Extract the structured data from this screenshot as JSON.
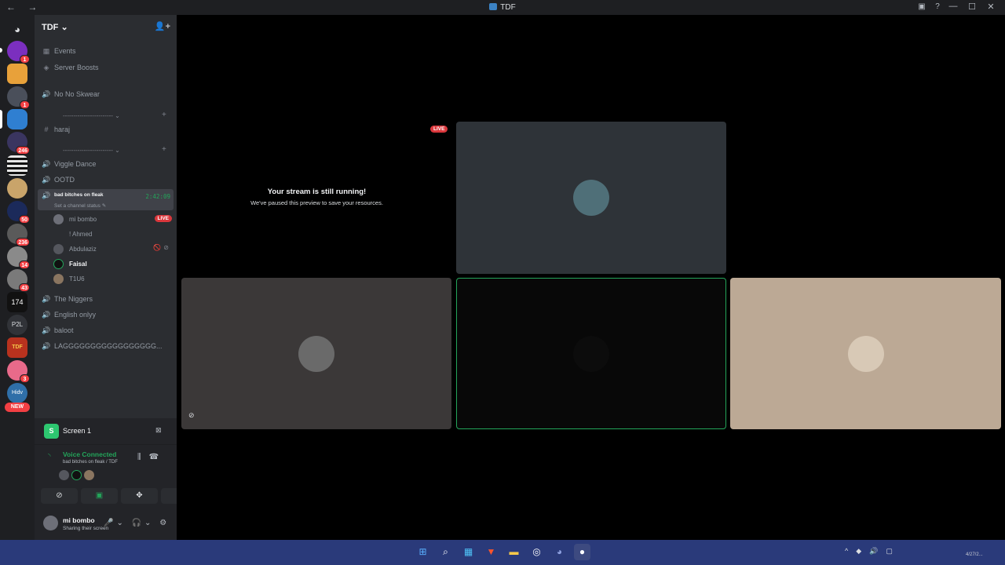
{
  "window": {
    "title": "TDF",
    "nav": "← →",
    "controls": [
      "—",
      "☐",
      "✕"
    ],
    "extra_icons": [
      "▣",
      "?"
    ]
  },
  "servers": [
    {
      "name": "server-1",
      "color": "#7b2fbf",
      "badge": "1"
    },
    {
      "name": "server-2",
      "color": "#e8a13a",
      "badge": ""
    },
    {
      "name": "server-3",
      "color": "#4a4f5a",
      "badge": "1"
    },
    {
      "name": "server-4",
      "color": "#2f7fd1",
      "badge": ""
    },
    {
      "name": "server-5",
      "color": "#3a3560",
      "badge": "246"
    },
    {
      "name": "server-6",
      "color": "#e6e6e6",
      "badge": ""
    },
    {
      "name": "server-7",
      "color": "#c9a46a",
      "badge": ""
    },
    {
      "name": "server-8",
      "color": "#1b2a5a",
      "badge": "50"
    },
    {
      "name": "server-9",
      "color": "#5a5a5a",
      "badge": "236"
    },
    {
      "name": "server-10",
      "color": "#8a8a8a",
      "badge": "14"
    },
    {
      "name": "server-11",
      "color": "#7a7a7a",
      "badge": "43"
    },
    {
      "name": "server-12",
      "color": "#111111",
      "badge": "",
      "text": "174"
    },
    {
      "name": "server-13",
      "color": "#313338",
      "badge": "",
      "text": "P2L"
    },
    {
      "name": "server-14",
      "color": "#b8321e",
      "badge": "",
      "text": "TDF"
    },
    {
      "name": "server-15",
      "color": "#e86a8a",
      "badge": "3"
    },
    {
      "name": "server-16",
      "color": "#2f6fa8",
      "badge": "",
      "text": "Hidv"
    }
  ],
  "new_label": "NEW",
  "guild": {
    "name": "TDF ⌄",
    "items": [
      {
        "icon": "▦",
        "label": "Events"
      },
      {
        "icon": "◈",
        "label": "Server Boosts"
      },
      {
        "icon": "🔊",
        "label": "No No Skwear"
      }
    ],
    "category_1": "------------------------ ⌄",
    "category_2": "------------------------ ⌄",
    "text_channel": "haraj",
    "voice_channels_a": [
      "Viggle Dance",
      "OOTD"
    ],
    "active_channel": {
      "name": "bad bitches on fleak",
      "timer": "2:42:09",
      "status": "Set a channel status ✎"
    },
    "members": [
      {
        "name": "mi bombo",
        "live": "LIVE"
      },
      {
        "name": "! Ahmed",
        "live": ""
      },
      {
        "name": "Abdulaziz",
        "live": ""
      },
      {
        "name": "Faisal",
        "live": ""
      },
      {
        "name": "T1U6",
        "live": ""
      }
    ],
    "voice_channels_b": [
      "The Niggers",
      "English onlyy",
      "baloot",
      "LAGGGGGGGGGGGGGGGGG..."
    ]
  },
  "panel": {
    "screen_label": "Screen 1",
    "screen_icon_text": "S",
    "voice_title": "Voice Connected",
    "voice_sub": "bad bitches on fleak / TDF",
    "user_name": "mi bombo",
    "user_status": "Sharing their screen"
  },
  "stage": {
    "paused_title": "Your stream is still running!",
    "paused_sub": "We've paused this preview to save your resources.",
    "live_tag": "LIVE",
    "tiles": [
      {
        "name": "stream-tile-top",
        "bg": "#2e3338"
      },
      {
        "name": "user-tile-left",
        "bg": "#3b3838"
      },
      {
        "name": "user-tile-center",
        "bg": "#080808"
      },
      {
        "name": "user-tile-right",
        "bg": "#bca995"
      }
    ]
  },
  "taskbar": {
    "apps": [
      "start",
      "search",
      "files-app",
      "brave",
      "explorer",
      "steam",
      "discord",
      "obs"
    ],
    "clock": "4/27/2..."
  }
}
